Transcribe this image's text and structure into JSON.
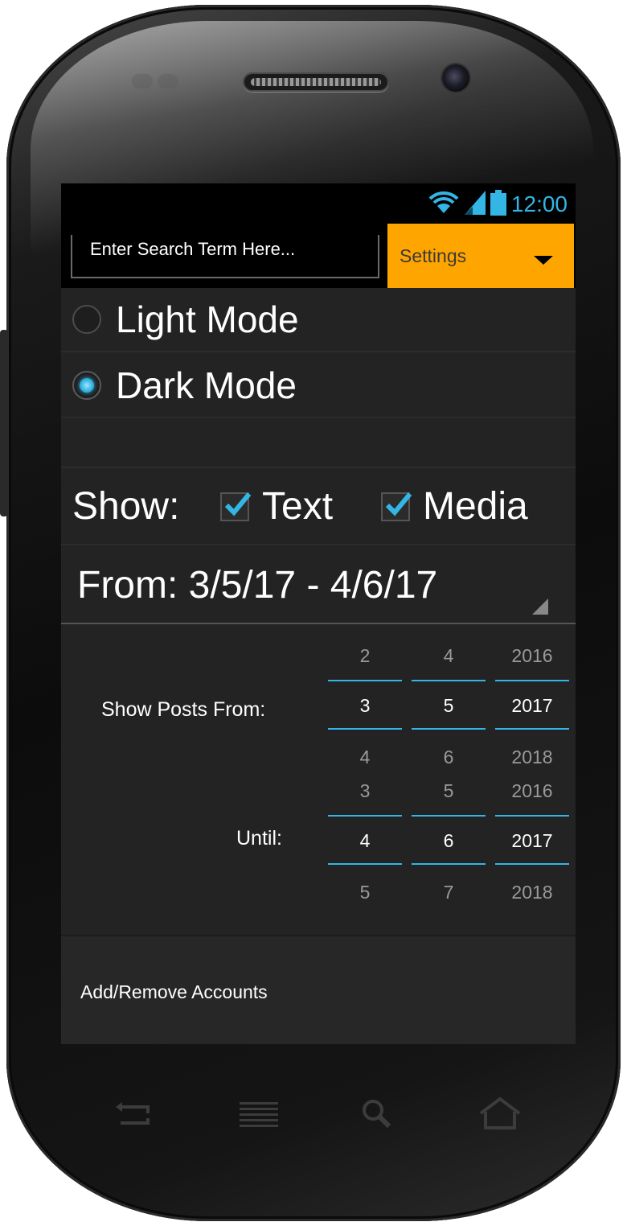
{
  "status_bar": {
    "time": "12:00"
  },
  "action_bar": {
    "search_placeholder": "Enter Search Term Here...",
    "settings_label": "Settings"
  },
  "theme": {
    "options": [
      {
        "label": "Light Mode",
        "checked": false
      },
      {
        "label": "Dark Mode",
        "checked": true
      }
    ]
  },
  "show": {
    "label": "Show:",
    "text_label": "Text",
    "media_label": "Media",
    "text_checked": true,
    "media_checked": true
  },
  "date_range": {
    "text": "From: 3/5/17 - 4/6/17"
  },
  "picker": {
    "from_label": "Show Posts From:",
    "until_label": "Until:",
    "from": {
      "month": {
        "prev": "2",
        "value": "3",
        "next": "4"
      },
      "day": {
        "prev": "4",
        "value": "5",
        "next": "6"
      },
      "year": {
        "prev": "2016",
        "value": "2017",
        "next": "2018"
      }
    },
    "until": {
      "month": {
        "prev": "3",
        "value": "4",
        "next": "5"
      },
      "day": {
        "prev": "5",
        "value": "6",
        "next": "7"
      },
      "year": {
        "prev": "2016",
        "value": "2017",
        "next": "2018"
      }
    }
  },
  "accounts": {
    "label": "Add/Remove Accounts"
  },
  "colors": {
    "accent": "#33b5e5",
    "settings_bg": "#ffa500",
    "screen_bg": "#232323"
  },
  "nav_icons": [
    "back-icon",
    "menu-icon",
    "search-icon",
    "home-icon"
  ]
}
